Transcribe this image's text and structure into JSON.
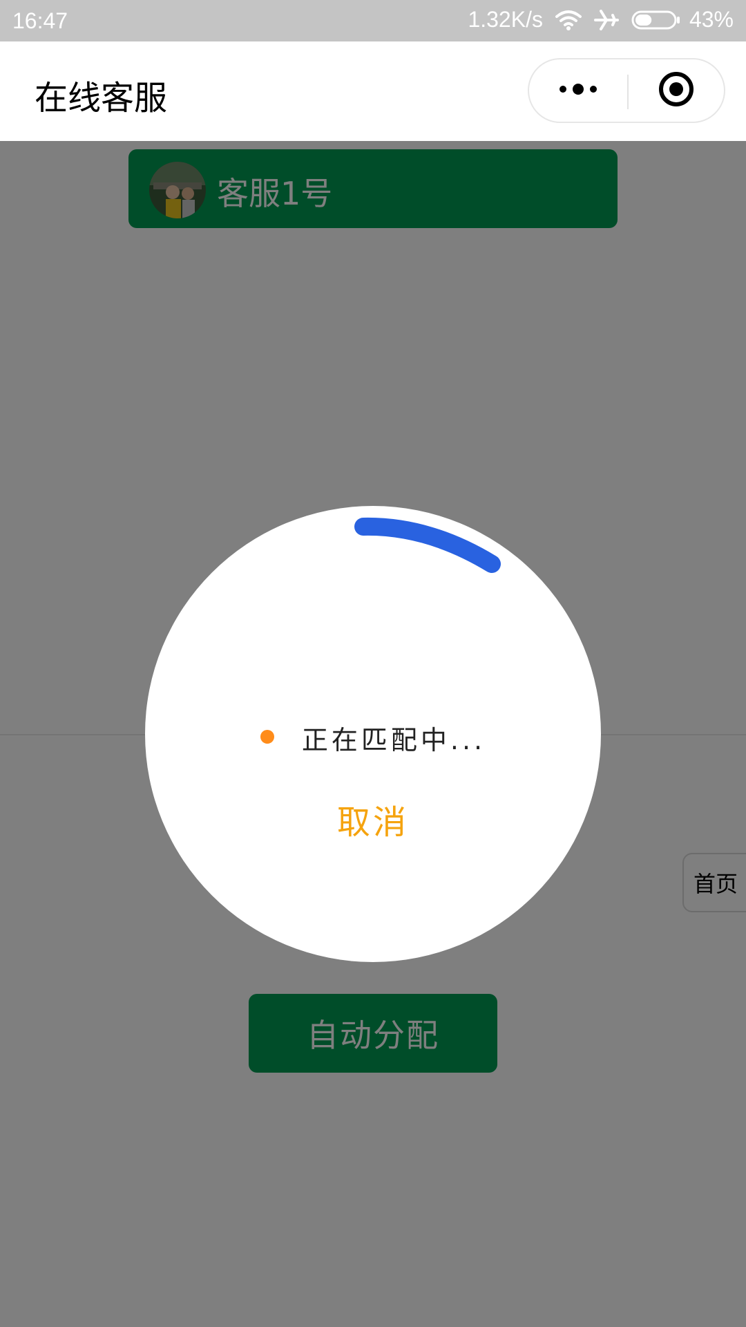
{
  "status_bar": {
    "time": "16:47",
    "network_speed": "1.32K/s",
    "battery_percent": "43%",
    "battery_level": 0.43,
    "icons": [
      "wifi-icon",
      "airplane-icon",
      "battery-icon"
    ]
  },
  "nav": {
    "title": "在线客服",
    "capsule_icons": [
      "more-icon",
      "close-target-icon"
    ]
  },
  "agent": {
    "name": "客服1号",
    "avatar_icon": "avatar"
  },
  "auto_assign": {
    "label": "自动分配"
  },
  "home_tab": {
    "label": "首页"
  },
  "dialog": {
    "status_text": "正在匹配中...",
    "cancel_label": "取消"
  },
  "colors": {
    "brand_green": "#009b52",
    "spinner_blue": "#2962e0",
    "cancel_orange": "#f5a30e",
    "dot_orange": "#ff8c1a"
  }
}
